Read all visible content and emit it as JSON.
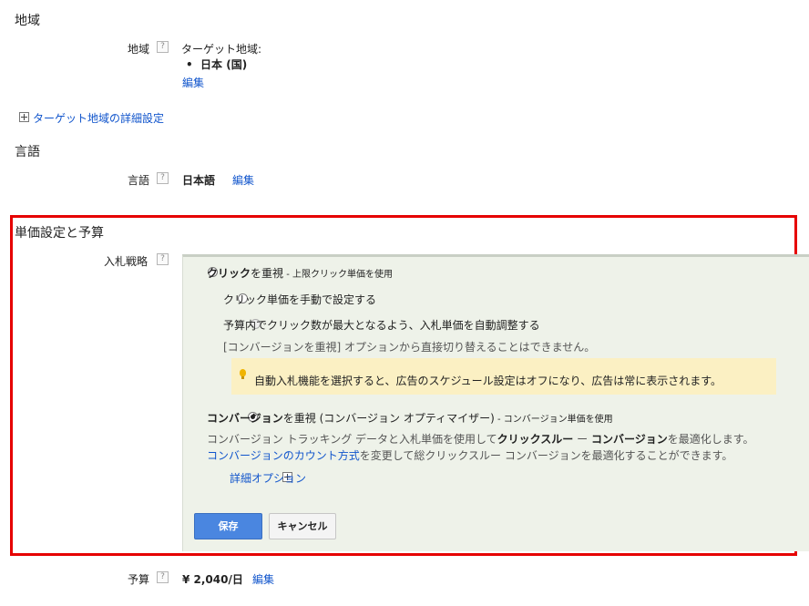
{
  "region_section": {
    "title": "地域",
    "label": "地域",
    "help": "?",
    "target_label": "ターゲット地域:",
    "target_item": "日本 (国)",
    "edit": "編集",
    "advanced_link": "ターゲット地域の詳細設定"
  },
  "language_section": {
    "title": "言語",
    "label": "言語",
    "help": "?",
    "value": "日本語",
    "edit": "編集"
  },
  "bidding_section": {
    "title": "単価設定と予算",
    "strategy_label": "入札戦略",
    "help": "?",
    "opt_click": {
      "bold": "クリック",
      "rest": "を重視",
      "sub": " - 上限クリック単価を使用",
      "manual": "クリック単価を手動で設定する",
      "auto": "予算内でクリック数が最大となるよう、入札単価を自動調整する",
      "note": "[コンバージョンを重視] オプションから直接切り替えることはできません。"
    },
    "tip": "自動入札機能を選択すると、広告のスケジュール設定はオフになり、広告は常に表示されます。",
    "opt_conversion": {
      "bold": "コンバージョン",
      "rest": "を重視 (コンバージョン オプティマイザー)",
      "sub": " - コンバージョン単価を使用",
      "desc_pre": "コンバージョン トラッキング データと入札単価を使用して",
      "desc_bold1": "クリックスルー",
      "desc_mid": " ー ",
      "desc_bold2": "コンバージョン",
      "desc_post": "を最適化します。",
      "count_link": "コンバージョンのカウント方式",
      "count_rest": "を変更して総クリックスルー コンバージョンを最適化することができます。",
      "advanced": "詳細オプション"
    },
    "save": "保存",
    "cancel": "キャンセル"
  },
  "budget": {
    "label": "予算",
    "help": "?",
    "value": "¥ 2,040/日",
    "edit": "編集"
  },
  "colors": {
    "highlight_frame": "#e60000",
    "link": "#1155cc",
    "panel_bg": "#eef2e9",
    "tip_bg": "#fbf0c3",
    "save_button": "#4a86e0"
  }
}
